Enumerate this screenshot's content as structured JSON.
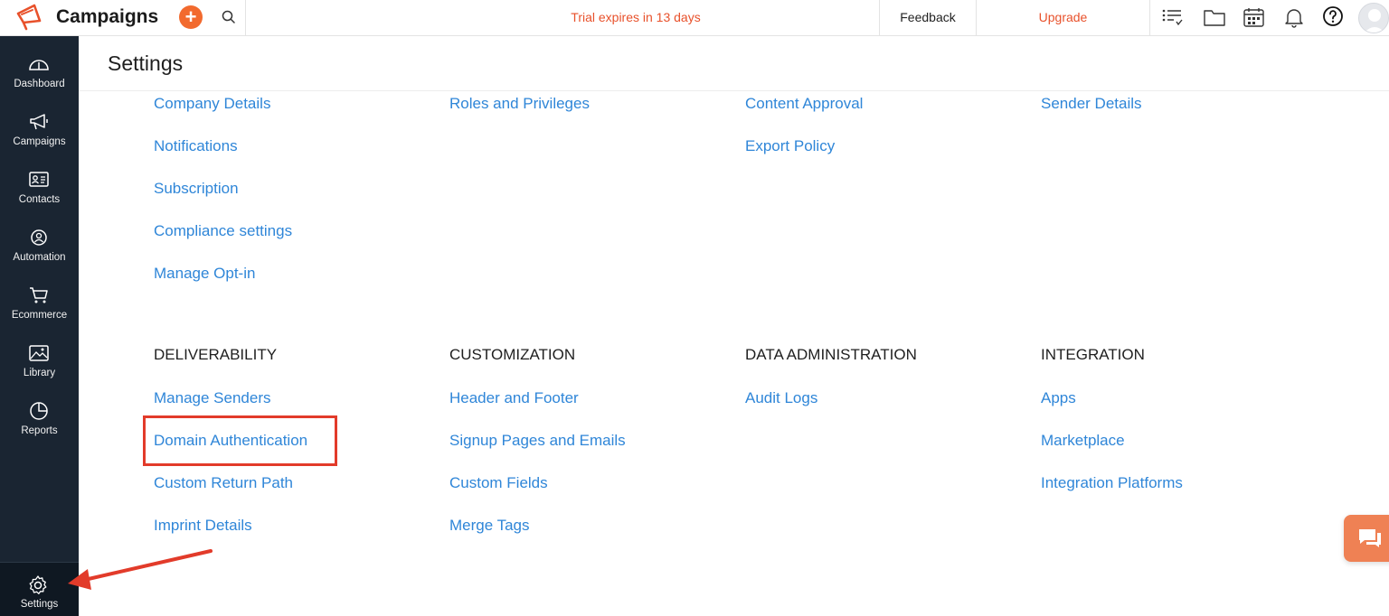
{
  "header": {
    "app_title": "Campaigns",
    "add_label": "+",
    "trial_text": "Trial expires in 13 days",
    "feedback_label": "Feedback",
    "upgrade_label": "Upgrade"
  },
  "icons": {
    "logo": "megaphone-logo-icon",
    "search": "search-icon",
    "list": "list-icon",
    "folder": "folder-icon",
    "calendar": "calendar-icon",
    "bell": "bell-icon",
    "help": "help-icon",
    "avatar": "avatar-icon",
    "chat": "chat-icon"
  },
  "sidebar": {
    "items": [
      {
        "label": "Dashboard"
      },
      {
        "label": "Campaigns"
      },
      {
        "label": "Contacts"
      },
      {
        "label": "Automation"
      },
      {
        "label": "Ecommerce"
      },
      {
        "label": "Library"
      },
      {
        "label": "Reports"
      }
    ],
    "settings_label": "Settings"
  },
  "main": {
    "page_title": "Settings",
    "top_links": {
      "col1": [
        "Company Details",
        "Notifications",
        "Subscription",
        "Compliance settings",
        "Manage Opt-in"
      ],
      "col2": [
        "Roles and Privileges"
      ],
      "col3": [
        "Content Approval",
        "Export Policy"
      ],
      "col4": [
        "Sender Details"
      ]
    },
    "sections": [
      {
        "heading": "DELIVERABILITY",
        "links": [
          "Manage Senders",
          "Domain Authentication",
          "Custom Return Path",
          "Imprint Details"
        ]
      },
      {
        "heading": "CUSTOMIZATION",
        "links": [
          "Header and Footer",
          "Signup Pages and Emails",
          "Custom Fields",
          "Merge Tags"
        ]
      },
      {
        "heading": "DATA ADMINISTRATION",
        "links": [
          "Audit Logs"
        ]
      },
      {
        "heading": "INTEGRATION",
        "links": [
          "Apps",
          "Marketplace",
          "Integration Platforms"
        ]
      }
    ]
  },
  "colors": {
    "accent": "#f26a2e",
    "link": "#2f86d8",
    "sidebar": "#1a2532",
    "highlight": "#e23b2a"
  }
}
